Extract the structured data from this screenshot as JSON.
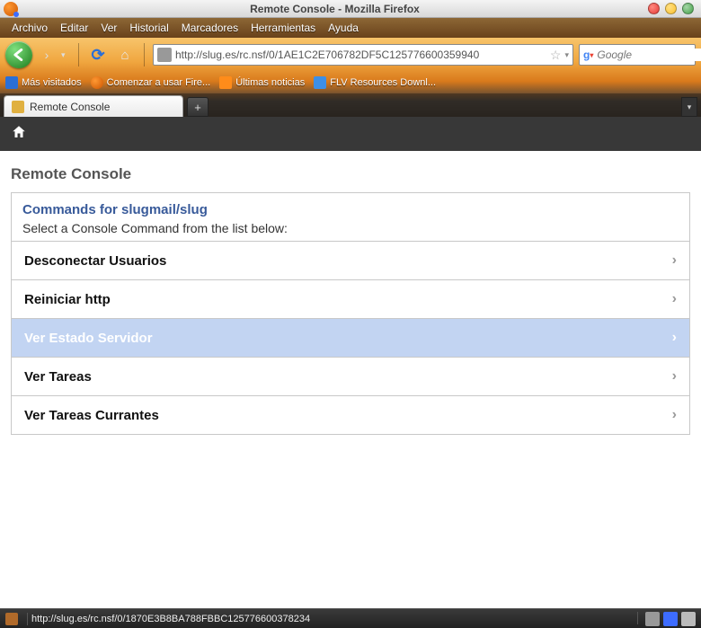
{
  "window": {
    "title": "Remote Console - Mozilla Firefox"
  },
  "menu": {
    "file": "Archivo",
    "edit": "Editar",
    "view": "Ver",
    "history": "Historial",
    "bookmarks": "Marcadores",
    "tools": "Herramientas",
    "help": "Ayuda"
  },
  "url": {
    "value": "http://slug.es/rc.nsf/0/1AE1C2E706782DF5C125776600359940"
  },
  "search": {
    "placeholder": "Google"
  },
  "bookmarks_bar": {
    "most_visited": "Más visitados",
    "getting_started": "Comenzar a usar Fire...",
    "latest_news": "Últimas noticias",
    "flv": "FLV Resources Downl..."
  },
  "tabs": {
    "active": "Remote Console",
    "new_tab_label": "+"
  },
  "content": {
    "page_title": "Remote Console",
    "panel_heading": "Commands for slugmail/slug",
    "panel_sub": "Select a Console Command from the list below:",
    "commands": [
      {
        "label": "Desconectar Usuarios",
        "selected": false
      },
      {
        "label": "Reiniciar http",
        "selected": false
      },
      {
        "label": "Ver Estado Servidor",
        "selected": true
      },
      {
        "label": "Ver Tareas",
        "selected": false
      },
      {
        "label": "Ver Tareas Currantes",
        "selected": false
      }
    ]
  },
  "status": {
    "text": "http://slug.es/rc.nsf/0/1870E3B8BA788FBBC125776600378234"
  }
}
